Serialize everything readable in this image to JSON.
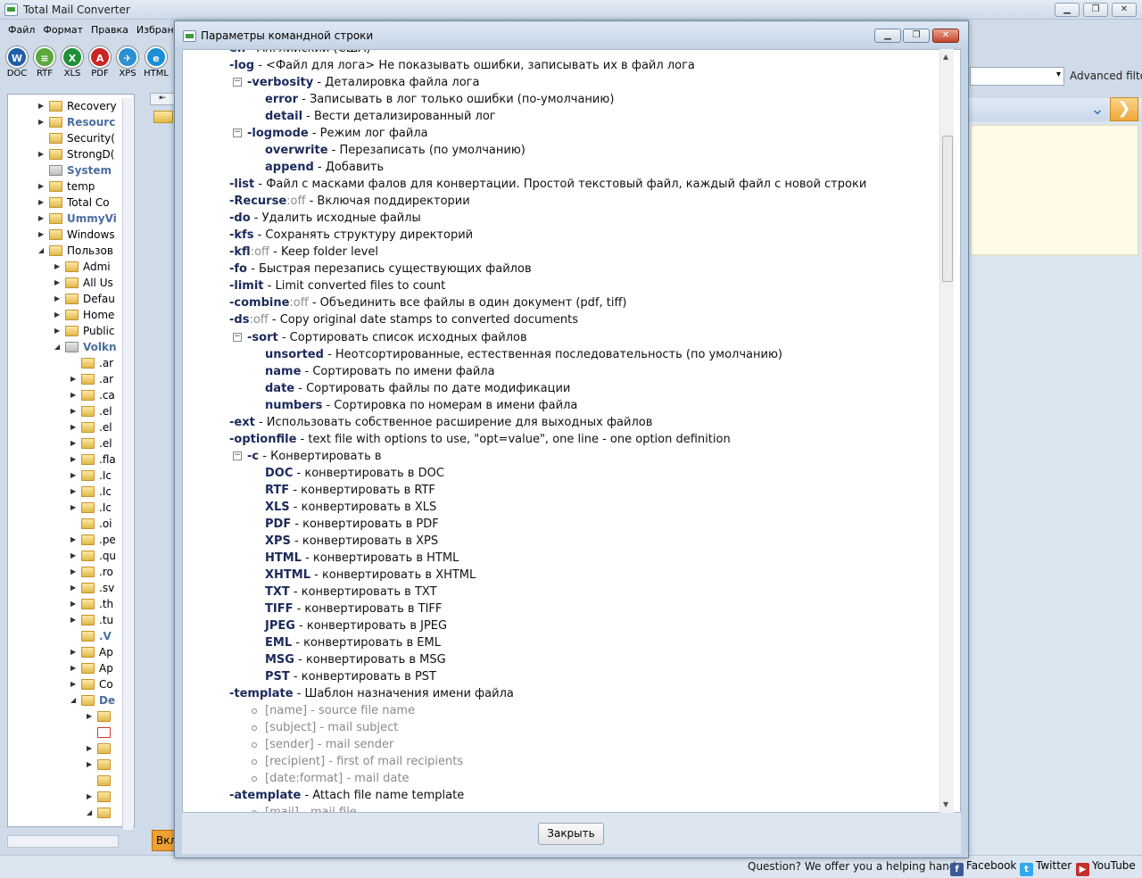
{
  "app": {
    "title": "Total Mail Converter",
    "min": "▁",
    "max": "❐",
    "close": "✕"
  },
  "menu": [
    "Файл",
    "Формат",
    "Правка",
    "Избран"
  ],
  "toolbar": [
    {
      "label": "DOC",
      "color": "#1e5ea8",
      "glyph": "W"
    },
    {
      "label": "RTF",
      "color": "#5aa93c",
      "glyph": "≡"
    },
    {
      "label": "XLS",
      "color": "#1f8f3a",
      "glyph": "X"
    },
    {
      "label": "PDF",
      "color": "#c92525",
      "glyph": "A"
    },
    {
      "label": "XPS",
      "color": "#2a8fd4",
      "glyph": "✈"
    },
    {
      "label": "HTML",
      "color": "#1a8fd6",
      "glyph": "e"
    }
  ],
  "tree": [
    {
      "l": 45,
      "t": 0,
      "a": "▶",
      "n": "Recovery",
      "c": ""
    },
    {
      "l": 45,
      "t": 18,
      "a": "▶",
      "n": "Resourc",
      "c": "bold"
    },
    {
      "l": 45,
      "t": 36,
      "a": "",
      "n": "Security(",
      "c": ""
    },
    {
      "l": 45,
      "t": 54,
      "a": "▶",
      "n": "StrongD(",
      "c": ""
    },
    {
      "l": 45,
      "t": 72,
      "a": "",
      "n": "System",
      "c": "bold",
      "s": 1
    },
    {
      "l": 45,
      "t": 90,
      "a": "▶",
      "n": "temp",
      "c": ""
    },
    {
      "l": 45,
      "t": 108,
      "a": "▶",
      "n": "Total Co",
      "c": ""
    },
    {
      "l": 45,
      "t": 126,
      "a": "▶",
      "n": "UmmyVi",
      "c": "bold"
    },
    {
      "l": 45,
      "t": 144,
      "a": "▶",
      "n": "Windows",
      "c": ""
    },
    {
      "l": 45,
      "t": 162,
      "a": "◢",
      "n": "Пользов",
      "c": ""
    },
    {
      "l": 63,
      "t": 180,
      "a": "▶",
      "n": "Admi",
      "c": ""
    },
    {
      "l": 63,
      "t": 198,
      "a": "▶",
      "n": "All Us",
      "c": ""
    },
    {
      "l": 63,
      "t": 216,
      "a": "▶",
      "n": "Defau",
      "c": ""
    },
    {
      "l": 63,
      "t": 234,
      "a": "▶",
      "n": "Home",
      "c": ""
    },
    {
      "l": 63,
      "t": 252,
      "a": "▶",
      "n": "Public",
      "c": ""
    },
    {
      "l": 63,
      "t": 270,
      "a": "◢",
      "n": "Volkn",
      "c": "bold",
      "s": 1
    },
    {
      "l": 81,
      "t": 288,
      "a": "",
      "n": ".ar",
      "c": ""
    },
    {
      "l": 81,
      "t": 306,
      "a": "▶",
      "n": ".ar",
      "c": ""
    },
    {
      "l": 81,
      "t": 324,
      "a": "▶",
      "n": ".ca",
      "c": ""
    },
    {
      "l": 81,
      "t": 342,
      "a": "▶",
      "n": ".el",
      "c": ""
    },
    {
      "l": 81,
      "t": 360,
      "a": "▶",
      "n": ".el",
      "c": ""
    },
    {
      "l": 81,
      "t": 378,
      "a": "▶",
      "n": ".el",
      "c": ""
    },
    {
      "l": 81,
      "t": 396,
      "a": "▶",
      "n": ".fla",
      "c": ""
    },
    {
      "l": 81,
      "t": 414,
      "a": "▶",
      "n": ".Ic",
      "c": ""
    },
    {
      "l": 81,
      "t": 432,
      "a": "▶",
      "n": ".Ic",
      "c": ""
    },
    {
      "l": 81,
      "t": 450,
      "a": "▶",
      "n": ".Ic",
      "c": ""
    },
    {
      "l": 81,
      "t": 468,
      "a": "",
      "n": ".oi",
      "c": ""
    },
    {
      "l": 81,
      "t": 486,
      "a": "▶",
      "n": ".pe",
      "c": ""
    },
    {
      "l": 81,
      "t": 504,
      "a": "▶",
      "n": ".qu",
      "c": ""
    },
    {
      "l": 81,
      "t": 522,
      "a": "▶",
      "n": ".ro",
      "c": ""
    },
    {
      "l": 81,
      "t": 540,
      "a": "▶",
      "n": ".sv",
      "c": ""
    },
    {
      "l": 81,
      "t": 558,
      "a": "▶",
      "n": ".th",
      "c": ""
    },
    {
      "l": 81,
      "t": 576,
      "a": "▶",
      "n": ".tu",
      "c": ""
    },
    {
      "l": 81,
      "t": 594,
      "a": "",
      "n": ".V",
      "c": "bold"
    },
    {
      "l": 81,
      "t": 612,
      "a": "▶",
      "n": "Ap",
      "c": ""
    },
    {
      "l": 81,
      "t": 630,
      "a": "▶",
      "n": "Ap",
      "c": ""
    },
    {
      "l": 81,
      "t": 648,
      "a": "▶",
      "n": "Co",
      "c": ""
    },
    {
      "l": 81,
      "t": 666,
      "a": "◢",
      "n": "De",
      "c": "bold"
    },
    {
      "l": 99,
      "t": 684,
      "a": "▶",
      "n": "",
      "c": ""
    },
    {
      "l": 99,
      "t": 702,
      "a": "",
      "n": "",
      "c": "",
      "r": 1
    },
    {
      "l": 99,
      "t": 720,
      "a": "▶",
      "n": "",
      "c": ""
    },
    {
      "l": 99,
      "t": 738,
      "a": "▶",
      "n": "",
      "c": ""
    },
    {
      "l": 99,
      "t": 756,
      "a": "",
      "n": "",
      "c": ""
    },
    {
      "l": 99,
      "t": 774,
      "a": "▶",
      "n": "",
      "c": ""
    },
    {
      "l": 99,
      "t": 792,
      "a": "◢",
      "n": "",
      "c": ""
    }
  ],
  "filter": {
    "label": "Advanced filter"
  },
  "status": {
    "question": "Question? We offer you a helping hand -",
    "facebook": "Facebook",
    "twitter": "Twitter",
    "youtube": "YouTube"
  },
  "dialog": {
    "title": "Параметры командной строки",
    "close_label": "Закрыть",
    "min": "▁",
    "max": "❐",
    "x": "✕"
  },
  "lines": [
    {
      "i": 0,
      "k": "en",
      "d": " - Английский (США)"
    },
    {
      "i": 0,
      "k": "-log",
      "d": " - <Файл для лога> Не показывать ошибки, записывать их в файл лога"
    },
    {
      "i": 1,
      "k": "-verbosity",
      "d": " - Деталировка файла лога",
      "m": 1
    },
    {
      "i": 2,
      "k": "error",
      "d": " - Записывать в лог только ошибки (по-умолчанию)"
    },
    {
      "i": 2,
      "k": "detail",
      "d": " - Вести детализированный лог"
    },
    {
      "i": 1,
      "k": "-logmode",
      "d": " - Режим лог файла",
      "m": 1
    },
    {
      "i": 2,
      "k": "overwrite",
      "d": " - Перезаписать (по умолчанию)"
    },
    {
      "i": 2,
      "k": "append",
      "d": " - Добавить"
    },
    {
      "i": 0,
      "k": "-list",
      "d": " - Файл с масками фалов для конвертации. Простой текстовый файл, каждый файл с новой строки"
    },
    {
      "i": 0,
      "k": "-Recurse",
      "o": ":off",
      "d": " - Включая поддиректории"
    },
    {
      "i": 0,
      "k": "-do",
      "d": " - Удалить исходные файлы"
    },
    {
      "i": 0,
      "k": "-kfs",
      "d": " - Сохранять структуру директорий"
    },
    {
      "i": 0,
      "k": "-kfl",
      "o": ":off",
      "d": " - Keep folder level"
    },
    {
      "i": 0,
      "k": "-fo",
      "d": " - Быстрая перезапись существующих файлов"
    },
    {
      "i": 0,
      "k": "-limit",
      "d": " - Limit converted files to count"
    },
    {
      "i": 0,
      "k": "-combine",
      "o": ":off",
      "d": " - Объединить все файлы в один документ (pdf, tiff)"
    },
    {
      "i": 0,
      "k": "-ds",
      "o": ":off",
      "d": " - Copy original date stamps to converted documents"
    },
    {
      "i": 1,
      "k": "-sort",
      "d": " - Сортировать список исходных файлов",
      "m": 1
    },
    {
      "i": 2,
      "k": "unsorted",
      "d": " - Неотсортированные, естественная последовательность (по умолчанию)"
    },
    {
      "i": 2,
      "k": "name",
      "d": " - Сортировать по имени файла"
    },
    {
      "i": 2,
      "k": "date",
      "d": " - Сортировать файлы по дате модификации"
    },
    {
      "i": 2,
      "k": "numbers",
      "d": " - Сортировка по номерам в имени файла"
    },
    {
      "i": 0,
      "k": "-ext",
      "d": " - Использовать собственное расширение для выходных файлов"
    },
    {
      "i": 0,
      "k": "-optionfile",
      "d": " - text file with options to use, \"opt=value\", one line - one option definition"
    },
    {
      "i": 1,
      "k": "-c",
      "d": " - Конвертировать в",
      "m": 1
    },
    {
      "i": 2,
      "k": "DOC",
      "d": " - конвертировать в DOC"
    },
    {
      "i": 2,
      "k": "RTF",
      "d": " - конвертировать в RTF"
    },
    {
      "i": 2,
      "k": "XLS",
      "d": " - конвертировать в XLS"
    },
    {
      "i": 2,
      "k": "PDF",
      "d": " - конвертировать в PDF"
    },
    {
      "i": 2,
      "k": "XPS",
      "d": " - конвертировать в XPS"
    },
    {
      "i": 2,
      "k": "HTML",
      "d": " - конвертировать в HTML"
    },
    {
      "i": 2,
      "k": "XHTML",
      "d": " - конвертировать в XHTML"
    },
    {
      "i": 2,
      "k": "TXT",
      "d": " - конвертировать в TXT"
    },
    {
      "i": 2,
      "k": "TIFF",
      "d": " - конвертировать в TIFF"
    },
    {
      "i": 2,
      "k": "JPEG",
      "d": " - конвертировать в JPEG"
    },
    {
      "i": 2,
      "k": "EML",
      "d": " - конвертировать в EML"
    },
    {
      "i": 2,
      "k": "MSG",
      "d": " - конвертировать в MSG"
    },
    {
      "i": 2,
      "k": "PST",
      "d": " - конвертировать в PST"
    },
    {
      "i": 0,
      "k": "-template",
      "d": " - Шаблон назначения имени файла"
    },
    {
      "i": 2,
      "g": "[name] - source file name",
      "b": 1
    },
    {
      "i": 2,
      "g": "[subject] - mail subject",
      "b": 1
    },
    {
      "i": 2,
      "g": "[sender] - mail sender",
      "b": 1
    },
    {
      "i": 2,
      "g": "[recipient] - first of mail recipients",
      "b": 1
    },
    {
      "i": 2,
      "g": "[date:format] - mail date",
      "b": 1
    },
    {
      "i": 0,
      "k": "-atemplate",
      "d": " - Attach file name template"
    },
    {
      "i": 2,
      "g": "[mail] - mail file",
      "b": 1
    }
  ],
  "partial": {
    "left_tab": "Вкл"
  }
}
